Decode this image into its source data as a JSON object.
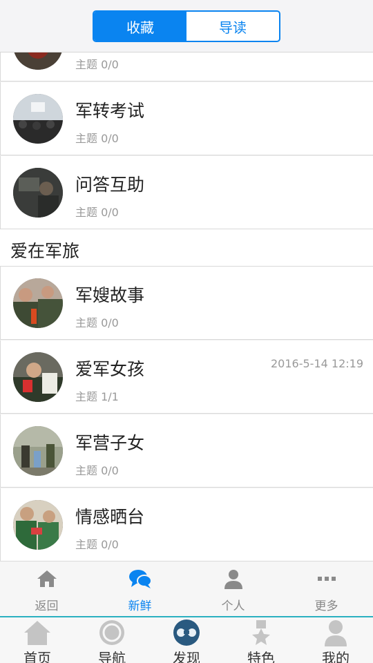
{
  "header": {
    "segments": [
      {
        "label": "收藏",
        "active": true
      },
      {
        "label": "导读",
        "active": false
      }
    ]
  },
  "list": {
    "partial_row": {
      "meta": "主题 0/0"
    },
    "rows_a": [
      {
        "title": "军转考试",
        "meta": "主题 0/0",
        "time": ""
      },
      {
        "title": "问答互助",
        "meta": "主题 0/0",
        "time": ""
      }
    ],
    "section_title": "爱在军旅",
    "rows_b": [
      {
        "title": "军嫂故事",
        "meta": "主题 0/0",
        "time": ""
      },
      {
        "title": "爱军女孩",
        "meta": "主题 1/1",
        "time": "2016-5-14 12:19"
      },
      {
        "title": "军营子女",
        "meta": "主题 0/0",
        "time": ""
      },
      {
        "title": "情感晒台",
        "meta": "主题 0/0",
        "time": ""
      }
    ]
  },
  "subtabs": [
    {
      "label": "返回",
      "icon": "home-icon"
    },
    {
      "label": "新鲜",
      "icon": "chat-bubbles-icon",
      "active": true
    },
    {
      "label": "个人",
      "icon": "person-icon"
    },
    {
      "label": "更多",
      "icon": "more-dots-icon"
    }
  ],
  "mainnav": [
    {
      "label": "首页",
      "icon": "house-icon"
    },
    {
      "label": "导航",
      "icon": "compass-icon"
    },
    {
      "label": "发现",
      "icon": "binoculars-icon"
    },
    {
      "label": "特色",
      "icon": "medal-icon"
    },
    {
      "label": "我的",
      "icon": "user-icon"
    }
  ],
  "colors": {
    "accent": "#0a84f0",
    "nav_divider": "#2ab0c0"
  }
}
